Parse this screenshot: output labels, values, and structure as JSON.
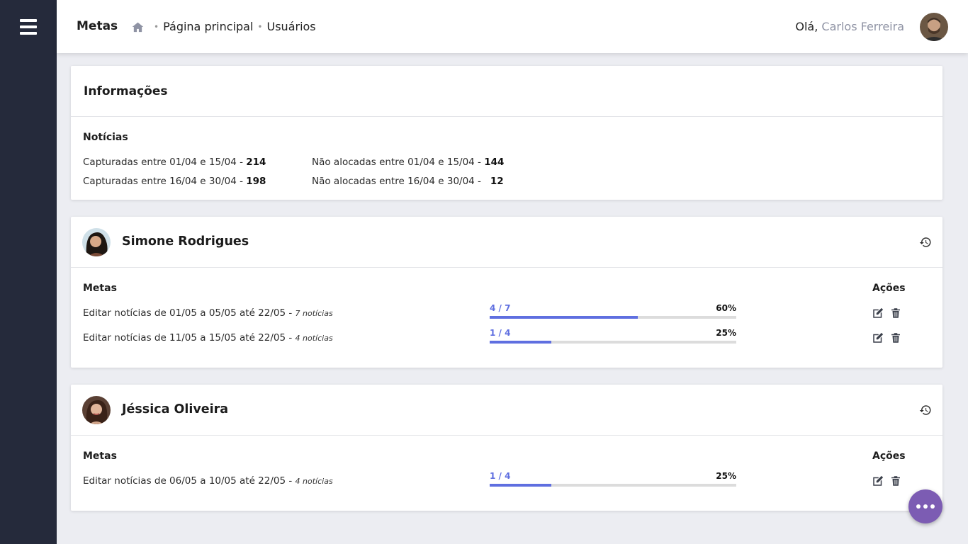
{
  "header": {
    "title": "Metas",
    "breadcrumb": [
      "Página principal",
      "Usuários"
    ],
    "greeting": "Olá,",
    "user_name": "Carlos Ferreira"
  },
  "info": {
    "title": "Informações",
    "section": "Notícias",
    "lines": [
      {
        "text": "Capturadas entre 01/04 e 15/04 - ",
        "value": "214"
      },
      {
        "text": "Capturadas entre 16/04 e 30/04 - ",
        "value": "198"
      },
      {
        "text": "Não alocadas entre 01/04 e 15/04 - ",
        "value": "144"
      },
      {
        "text": "Não alocadas entre 16/04 e 30/04 - ",
        "value": "12"
      }
    ]
  },
  "users": [
    {
      "name": "Simone Rodrigues",
      "metas_label": "Metas",
      "acoes_label": "Ações",
      "goals": [
        {
          "text": "Editar notícias de 01/05 a 05/05 até 22/05 - ",
          "count_label": "7 notícias",
          "progress": "4 / 7",
          "percent": "60%",
          "fill": 0.6
        },
        {
          "text": "Editar notícias de 11/05 a 15/05 até 22/05 - ",
          "count_label": "4 notícias",
          "progress": "1 / 4",
          "percent": "25%",
          "fill": 0.25
        }
      ]
    },
    {
      "name": "Jéssica Oliveira",
      "metas_label": "Metas",
      "acoes_label": "Ações",
      "goals": [
        {
          "text": "Editar notícias de 06/05 a 10/05 até 22/05 - ",
          "count_label": "4 notícias",
          "progress": "1 / 4",
          "percent": "25%",
          "fill": 0.25
        }
      ]
    }
  ],
  "colors": {
    "sidebar": "#252a3b",
    "accent": "#5f6fe0",
    "fab": "#7c5cb3"
  },
  "icons": [
    "menu-icon",
    "home-icon",
    "history-icon",
    "edit-icon",
    "trash-icon",
    "more-icon"
  ]
}
